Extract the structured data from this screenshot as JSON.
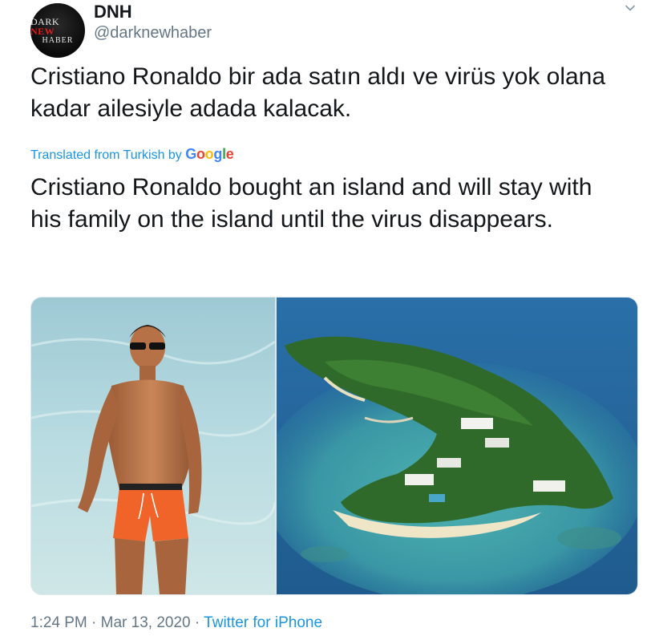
{
  "user": {
    "name": "DNH",
    "handle": "@darknewhaber",
    "avatar_text": {
      "line1_a": "DARK",
      "line1_b": "NEW",
      "line2": "HABER"
    }
  },
  "tweet": {
    "text": "Cristiano Ronaldo bir ada satın aldı ve virüs yok olana kadar ailesiyle adada kalacak.",
    "translated_label": "Translated from Turkish by",
    "translated_by": "Google",
    "translation": "Cristiano Ronaldo bought an island and will stay with his family on the island until the virus disappears."
  },
  "media": {
    "images": [
      "man-on-beach-photo",
      "island-aerial-photo"
    ]
  },
  "footer": {
    "time": "1:24 PM",
    "separator": "·",
    "date": "Mar 13, 2020",
    "source": "Twitter for iPhone"
  },
  "colors": {
    "link": "#1b95e0",
    "secondary_text": "#657786",
    "primary_text": "#14171a"
  },
  "icons": [
    "chevron-down-icon"
  ]
}
